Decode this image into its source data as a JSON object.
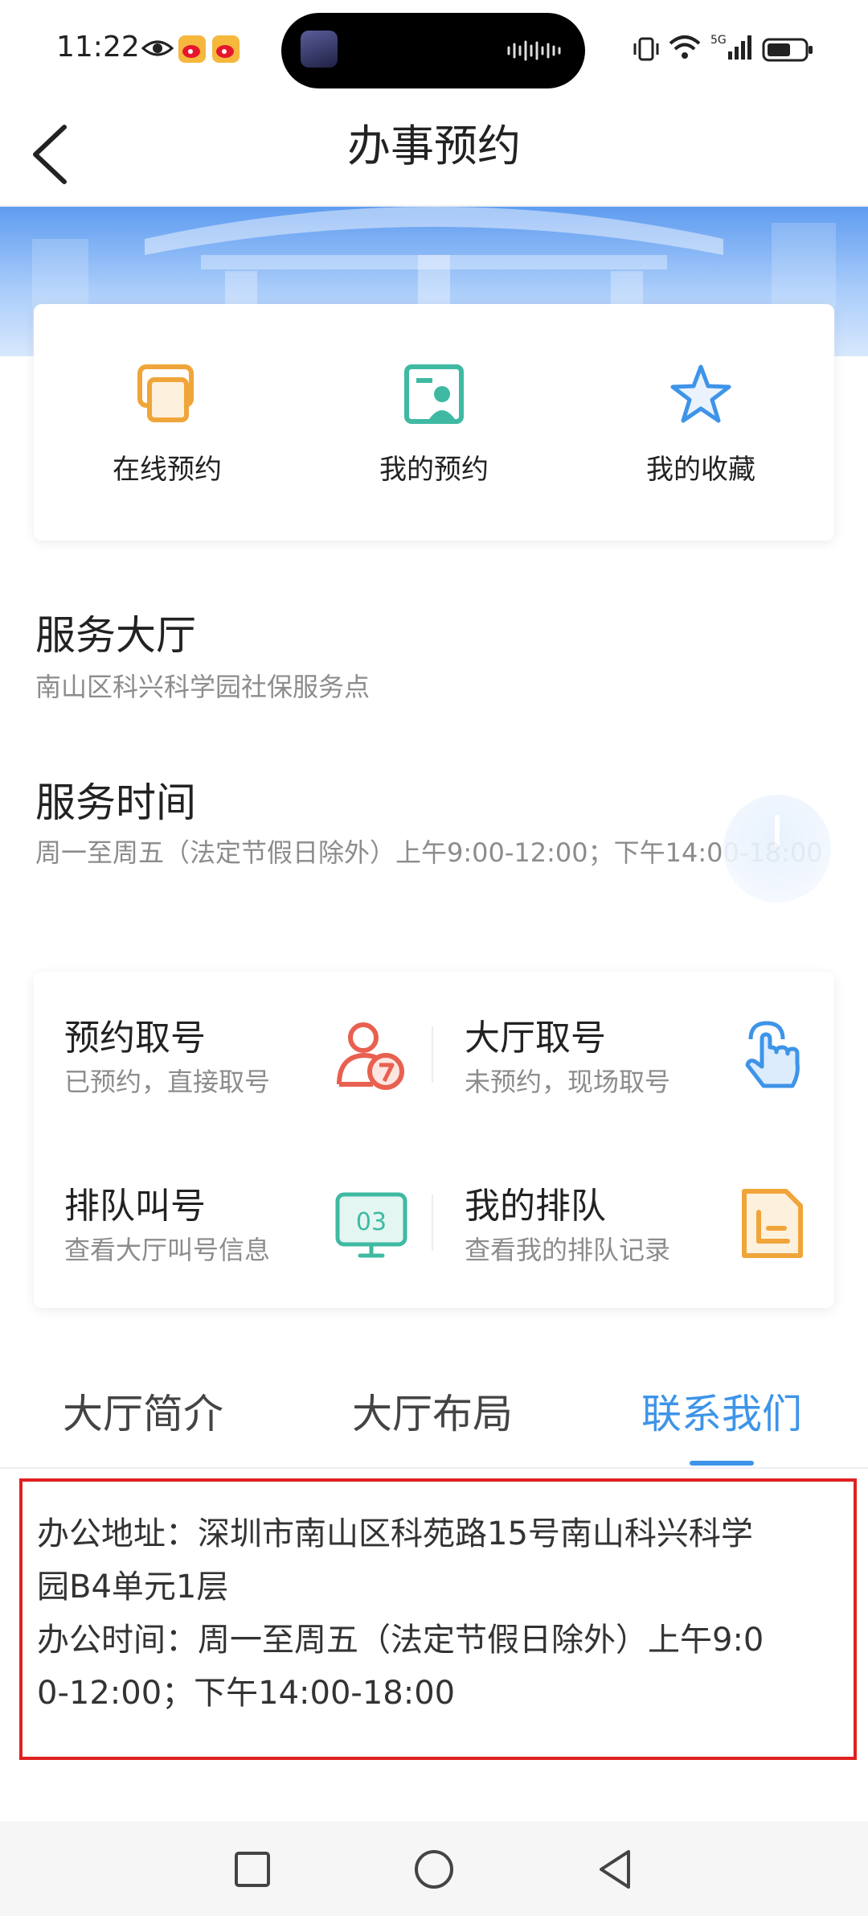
{
  "status_bar": {
    "time": "11:22",
    "icons": [
      "eye-icon",
      "weibo-icon",
      "weibo-icon",
      "vibrate-icon",
      "wifi-icon",
      "signal-5g-icon",
      "battery-icon"
    ],
    "network": "5G"
  },
  "header": {
    "back_icon": "chevron-left-icon",
    "title": "办事预约"
  },
  "quick_actions": [
    {
      "label": "在线预约",
      "icon": "online-booking-icon"
    },
    {
      "label": "我的预约",
      "icon": "my-booking-icon"
    },
    {
      "label": "我的收藏",
      "icon": "star-icon"
    }
  ],
  "service_hall": {
    "title": "服务大厅",
    "name": "南山区科兴科学园社保服务点"
  },
  "service_time": {
    "title": "服务时间",
    "value": "周一至周五（法定节假日除外）上午9:00-12:00；下午14:00-18:00"
  },
  "services": [
    {
      "title": "预约取号",
      "subtitle": "已预约，直接取号",
      "icon": "user-number-icon"
    },
    {
      "title": "大厅取号",
      "subtitle": "未预约，现场取号",
      "icon": "hand-tap-icon"
    },
    {
      "title": "排队叫号",
      "subtitle": "查看大厅叫号信息",
      "icon": "queue-display-icon",
      "badge": "03"
    },
    {
      "title": "我的排队",
      "subtitle": "查看我的排队记录",
      "icon": "document-icon"
    }
  ],
  "tabs": [
    {
      "label": "大厅简介",
      "active": false
    },
    {
      "label": "大厅布局",
      "active": false
    },
    {
      "label": "联系我们",
      "active": true
    }
  ],
  "contact": {
    "address_line1": "办公地址：深圳市南山区科苑路15号南山科兴科学",
    "address_line2": "园B4单元1层",
    "hours_line1": "办公时间：周一至周五（法定节假日除外）上午9:0",
    "hours_line2": "0-12:00；下午14:00-18:00"
  },
  "colors": {
    "accent": "#3e94e8",
    "highlight_border": "#e02020",
    "muted_text": "#8c8c8c"
  },
  "nav_bar": [
    "square-icon",
    "circle-icon",
    "back-triangle-icon"
  ]
}
